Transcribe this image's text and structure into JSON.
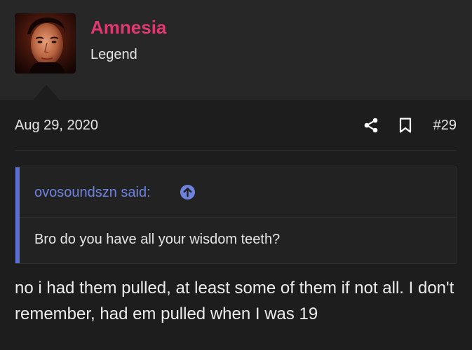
{
  "user": {
    "name": "Amnesia",
    "title": "Legend"
  },
  "post": {
    "date": "Aug 29, 2020",
    "number": "#29",
    "body": "no i had them pulled, at least some of them if not all. I don't remember, had em pulled when I was 19"
  },
  "quote": {
    "author": "ovosoundszn said:",
    "text": "Bro do you have all your wisdom teeth?"
  },
  "colors": {
    "username": "#e0396f",
    "quote_accent": "#5a6fd1",
    "background": "#1d1d1d",
    "header_background": "#272727"
  },
  "icons": {
    "share": "share-icon",
    "bookmark": "bookmark-icon",
    "quote_jump": "arrow-up-circle-icon"
  }
}
